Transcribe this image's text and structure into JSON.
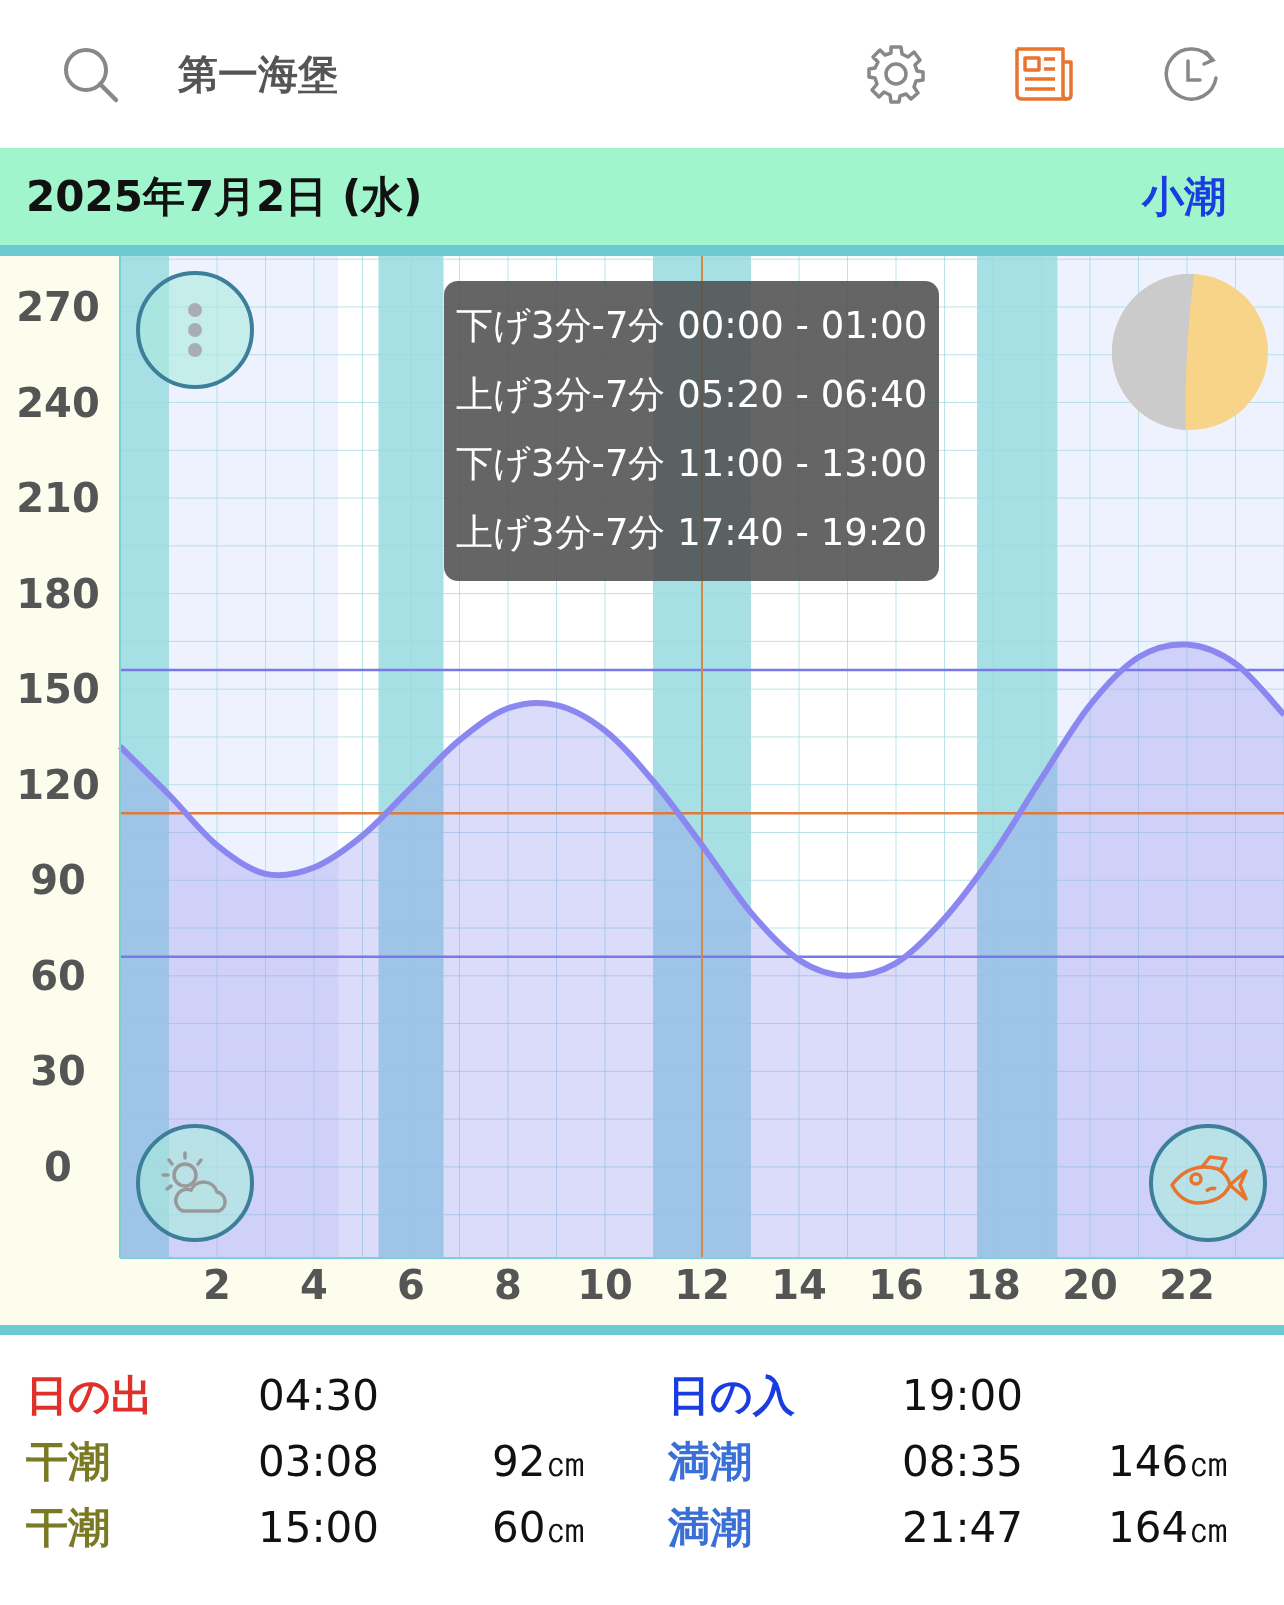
{
  "header": {
    "title": "第一海堡"
  },
  "date_bar": {
    "date": "2025年7月2日 (水)",
    "tide_type": "小潮"
  },
  "chart": {
    "chart_data": {
      "type": "area",
      "x": [
        0,
        1,
        2,
        3,
        4,
        5,
        6,
        7,
        8,
        9,
        10,
        11,
        12,
        13,
        14,
        15,
        16,
        17,
        18,
        19,
        20,
        21,
        22,
        23,
        24
      ],
      "series": [
        {
          "color": "#8b87f0",
          "values": [
            132,
            117,
            101,
            92,
            94,
            104,
            119,
            134,
            144,
            145,
            137,
            121,
            101,
            80,
            65,
            60,
            64,
            78,
            98,
            122,
            145,
            160,
            164,
            158,
            142
          ]
        }
      ],
      "xlim": [
        0,
        24
      ],
      "ylim": [
        -28.6,
        286
      ],
      "xticks": [
        2,
        4,
        6,
        8,
        10,
        12,
        14,
        16,
        18,
        20,
        22
      ],
      "yticks": [
        0,
        30,
        60,
        90,
        120,
        150,
        180,
        210,
        240,
        270
      ],
      "grid": true,
      "bands": [
        {
          "axis": "x",
          "from": 1,
          "to": 4.5,
          "color": "#eef1fe"
        },
        {
          "axis": "x",
          "from": 19.33,
          "to": 24,
          "color": "#eef1fe"
        },
        {
          "axis": "x",
          "from": 0,
          "to": 1,
          "color": "#a6dfe4"
        },
        {
          "axis": "x",
          "from": 5.33,
          "to": 6.67,
          "color": "#a6dfe4"
        },
        {
          "axis": "x",
          "from": 11,
          "to": 13,
          "color": "#a6dfe4"
        },
        {
          "axis": "x",
          "from": 17.67,
          "to": 19.33,
          "color": "#a6dfe4"
        }
      ],
      "ref_lines": [
        {
          "axis": "y",
          "value": 156,
          "color": "#7a78e8"
        },
        {
          "axis": "y",
          "value": 66,
          "color": "#7a78e8"
        },
        {
          "axis": "y",
          "value": 111,
          "color": "#e07a3a"
        },
        {
          "axis": "x",
          "value": 12,
          "color": "#d08a4a"
        }
      ]
    }
  },
  "tooltip": {
    "lines": [
      "下げ3分-7分 00:00 - 01:00",
      "上げ3分-7分 05:20 - 06:40",
      "下げ3分-7分 11:00 - 13:00",
      "上げ3分-7分 17:40 - 19:20"
    ]
  },
  "events": [
    {
      "left": {
        "label": "日の出",
        "color": "#e0302a",
        "time": "04:30"
      },
      "right": {
        "label": "日の入",
        "color": "#1a3de0",
        "time": "19:00"
      }
    },
    {
      "left": {
        "label": "干潮",
        "color": "#7a7a25",
        "time": "03:08",
        "height": "92㎝"
      },
      "right": {
        "label": "満潮",
        "color": "#3a6fd6",
        "time": "08:35",
        "height": "146㎝"
      }
    },
    {
      "left": {
        "label": "干潮",
        "color": "#7a7a25",
        "time": "15:00",
        "height": "60㎝"
      },
      "right": {
        "label": "満潮",
        "color": "#3a6fd6",
        "time": "21:47",
        "height": "164㎝"
      }
    }
  ]
}
